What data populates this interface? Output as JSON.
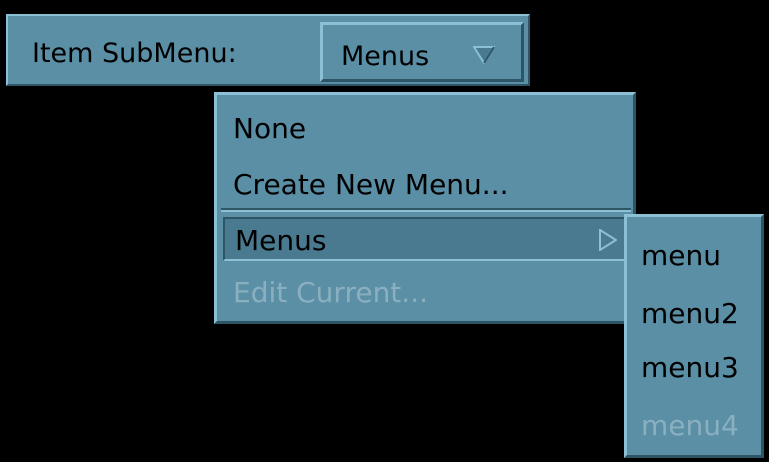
{
  "colors": {
    "background": "#000000",
    "panel": "#5a8fa6",
    "highlight": "#4a7a90",
    "shadow_light": "#8cc0d4",
    "shadow_dark": "#2e5566",
    "disabled_text": "#8ab0c0"
  },
  "toolbar": {
    "label": "Item SubMenu:",
    "option_value": "Menus",
    "option_icon": "triangle-down-icon"
  },
  "menu": {
    "items": [
      {
        "label": "None",
        "enabled": true
      },
      {
        "label": "Create New Menu...",
        "enabled": true
      },
      {
        "label": "Menus",
        "enabled": true,
        "highlighted": true,
        "cascade_icon": "triangle-right-icon"
      },
      {
        "label": "Edit Current...",
        "enabled": false
      }
    ]
  },
  "submenu": {
    "items": [
      {
        "label": "menu",
        "enabled": true
      },
      {
        "label": "menu2",
        "enabled": true
      },
      {
        "label": "menu3",
        "enabled": true
      },
      {
        "label": "menu4",
        "enabled": false
      }
    ]
  }
}
